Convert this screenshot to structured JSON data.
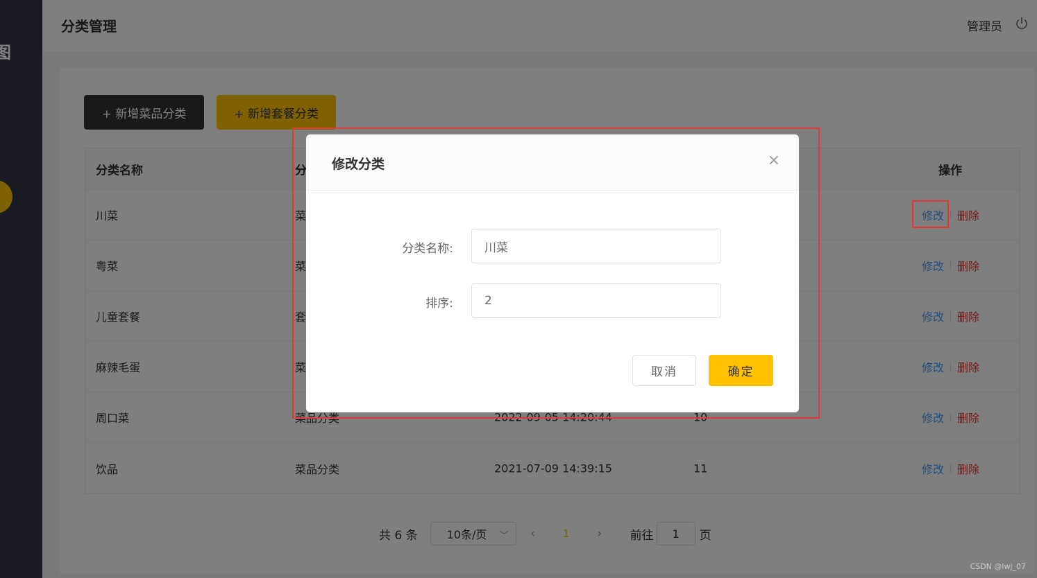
{
  "sidebar": {
    "logo_char": "图"
  },
  "header": {
    "title": "分类管理",
    "user": "管理员",
    "power_icon": "power-icon"
  },
  "toolbar": {
    "add_dish": "+ 新增菜品分类",
    "add_set": "+ 新增套餐分类"
  },
  "table": {
    "headers": {
      "name": "分类名称",
      "type": "分",
      "operations": "操作"
    },
    "rows": [
      {
        "name": "川菜",
        "type": "菜",
        "time": "",
        "sort": ""
      },
      {
        "name": "粤菜",
        "type": "菜",
        "time": "",
        "sort": ""
      },
      {
        "name": "儿童套餐",
        "type": "套",
        "time": "",
        "sort": ""
      },
      {
        "name": "麻辣毛蛋",
        "type": "菜",
        "time": "",
        "sort": ""
      },
      {
        "name": "周口菜",
        "type": "菜品分类",
        "time": "2022-09-05 14:20:44",
        "sort": "10"
      },
      {
        "name": "饮品",
        "type": "菜品分类",
        "time": "2021-07-09 14:39:15",
        "sort": "11"
      }
    ],
    "edit_label": "修改",
    "delete_label": "删除"
  },
  "pagination": {
    "total": "共 6 条",
    "page_size": "10条/页",
    "prev": "‹",
    "current": "1",
    "next": "›",
    "goto_label": "前往",
    "goto_value": "1",
    "page_unit": "页"
  },
  "dialog": {
    "title": "修改分类",
    "close": "×",
    "name_label": "分类名称:",
    "name_value": "川菜",
    "sort_label": "排序:",
    "sort_value": "2",
    "cancel": "取消",
    "confirm": "确定"
  },
  "watermark": "CSDN @lwj_07",
  "colors": {
    "accent": "#ffc200",
    "sidebar": "#343744",
    "highlight": "#e53935",
    "edit": "#419eff",
    "delete": "#fd3333"
  }
}
